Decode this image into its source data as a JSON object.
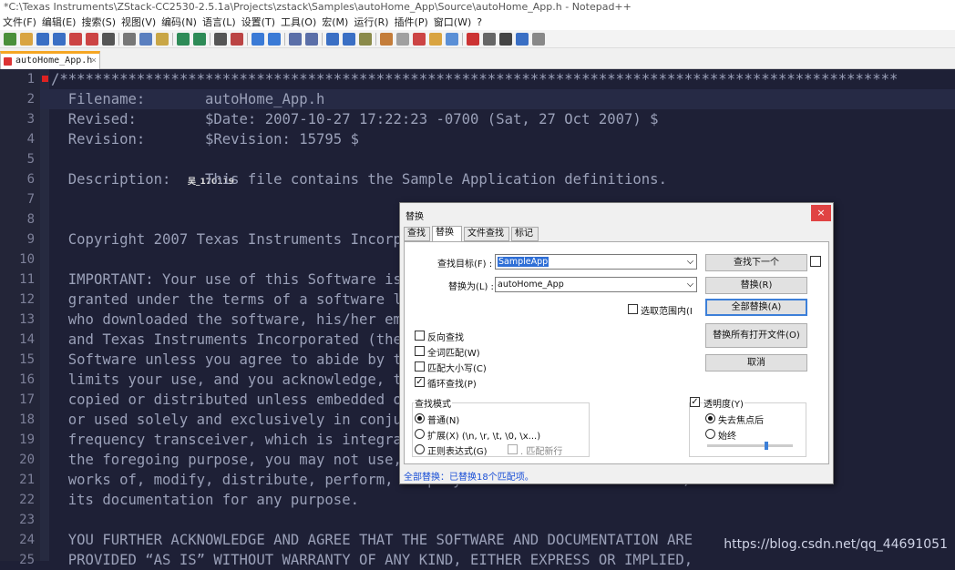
{
  "window": {
    "title": "*C:\\Texas Instruments\\ZStack-CC2530-2.5.1a\\Projects\\zstack\\Samples\\autoHome_App\\Source\\autoHome_App.h - Notepad++"
  },
  "menu": [
    "文件(F)",
    "编辑(E)",
    "搜索(S)",
    "视图(V)",
    "编码(N)",
    "语言(L)",
    "设置(T)",
    "工具(O)",
    "宏(M)",
    "运行(R)",
    "插件(P)",
    "窗口(W)",
    "?"
  ],
  "tab": {
    "label": "autoHome_App.h",
    "close": "×"
  },
  "editor": {
    "line_numbers": [
      "1",
      "2",
      "3",
      "4",
      "5",
      "6",
      "7",
      "8",
      "9",
      "10",
      "11",
      "12",
      "13",
      "14",
      "15",
      "16",
      "17",
      "18",
      "19",
      "20",
      "21",
      "22",
      "23",
      "24",
      "25"
    ],
    "lines": [
      "/**************************************************************************************************",
      "  Filename:       autoHome_App.h",
      "  Revised:        $Date: 2007-10-27 17:22:23 -0700 (Sat, 27 Oct 2007) $",
      "  Revision:       $Revision: 15795 $",
      "",
      "  Description:    This file contains the Sample Application definitions.",
      "",
      "",
      "  Copyright 2007 Texas Instruments Incorporated. All rights reserved.",
      "",
      "  IMPORTANT: Your use of this Software is limited to those specific rights",
      "  granted under the terms of a software license agreement between the user",
      "  who downloaded the software, his/her employer (which must be your employer)",
      "  and Texas Instruments Incorporated (the \"License\").  You may not use this",
      "  Software unless you agree to abide by the terms of the License. The License",
      "  limits your use, and you acknowledge, that the Software may not be modified,",
      "  copied or distributed unless embedded on a Texas Instruments microcontroller",
      "  or used solely and exclusively in conjunction with a Texas Instruments radio",
      "  frequency transceiver, which is integrated into your product.  Other than for",
      "  the foregoing purpose, you may not use, reproduce, copy, prepare derivative",
      "  works of, modify, distribute, perform, display or sell this Software and/or",
      "  its documentation for any purpose.",
      "",
      "  YOU FURTHER ACKNOWLEDGE AND AGREE THAT THE SOFTWARE AND DOCUMENTATION ARE",
      "  PROVIDED “AS IS” WITHOUT WARRANTY OF ANY KIND, EITHER EXPRESS OR IMPLIED,"
    ],
    "overlay_text": "吴_170119"
  },
  "dialog": {
    "title": "替换",
    "close": "×",
    "tabs": [
      "查找",
      "替换",
      "文件查找",
      "标记"
    ],
    "find_label": "查找目标(F) :",
    "find_value": "SampleApp",
    "replace_label": "替换为(L) :",
    "replace_value": "autoHome_App",
    "in_selection": "选取范围内(I",
    "buttons": {
      "find_next": "查找下一个",
      "replace": "替换(R)",
      "replace_all": "全部替换(A)",
      "replace_all_open": "替换所有打开文件(O)",
      "cancel": "取消"
    },
    "options": {
      "backward": "反向查找",
      "whole_word": "全词匹配(W)",
      "match_case": "匹配大小写(C)",
      "wrap": "循环查找(P)"
    },
    "search_mode": {
      "title": "查找模式",
      "normal": "普通(N)",
      "extended": "扩展(X) (\\n, \\r, \\t, \\0, \\x...)",
      "regex": "正则表达式(G)",
      "newline": ". 匹配新行"
    },
    "transparency": {
      "title": "透明度(Y)",
      "on_lose_focus": "失去焦点后",
      "always": "始终",
      "level": 0.7
    },
    "status": "全部替换：已替换18个匹配项。"
  },
  "watermark": "https://blog.csdn.net/qq_44691051"
}
